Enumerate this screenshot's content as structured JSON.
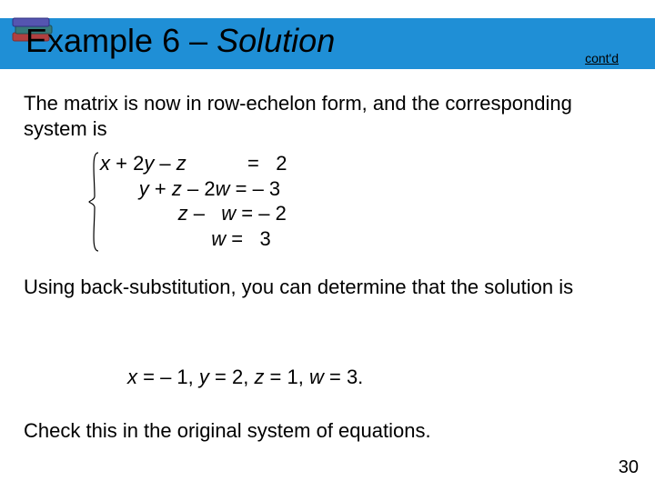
{
  "header": {
    "title_prefix": "Example 6 – ",
    "title_italic": "Solution",
    "contd": "cont'd"
  },
  "para1": "The matrix is now in row-echelon form, and the corresponding system is",
  "equations": [
    {
      "lhs_html": "<span class='var'>x</span> + 2<span class='var'>y</span> – <span class='var'>z</span>           ",
      "eq": "=",
      "rhs": "   2"
    },
    {
      "lhs_html": "       <span class='var'>y</span> + <span class='var'>z</span> – 2<span class='var'>w</span> ",
      "eq": "=",
      "rhs": " – 3"
    },
    {
      "lhs_html": "              <span class='var'>z</span> –   <span class='var'>w</span> ",
      "eq": "=",
      "rhs": " – 2"
    },
    {
      "lhs_html": "                    <span class='var'>w</span> ",
      "eq": "=",
      "rhs": "   3"
    }
  ],
  "para2": "Using back-substitution, you can determine that the solution is",
  "solution_html": "<span class='var'>x</span> = – 1, <span class='var'>y</span> = 2, <span class='var'>z</span> = 1, <span class='var'>w</span> = 3.",
  "para3": "Check this in the original system of equations.",
  "page_number": "30"
}
